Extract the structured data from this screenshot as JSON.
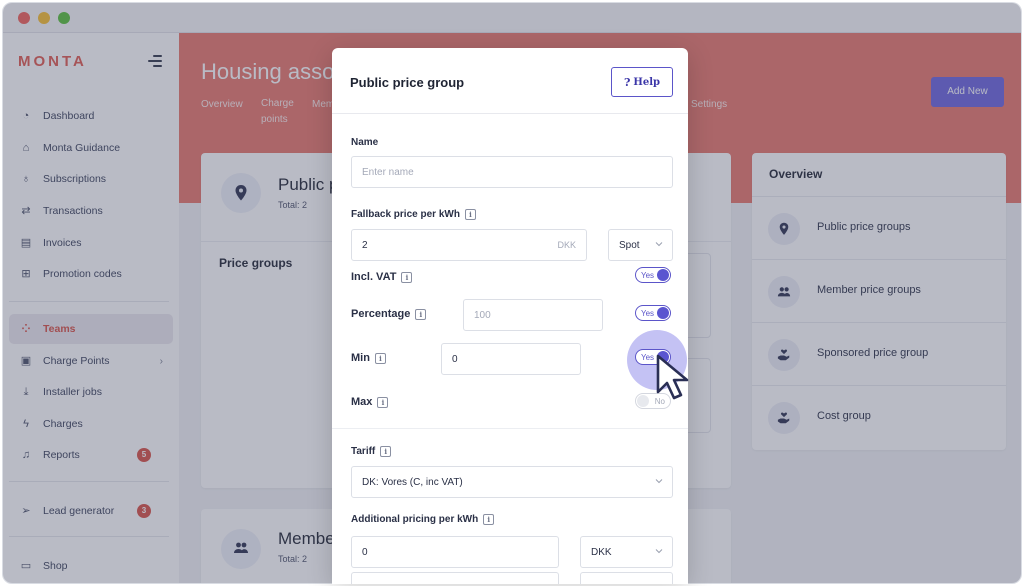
{
  "sidebar": {
    "logo": "MONTA",
    "items": [
      {
        "label": "Dashboard",
        "icon": "dashboard-icon"
      },
      {
        "label": "Monta Guidance",
        "icon": "home-icon"
      },
      {
        "label": "Subscriptions",
        "icon": "bulb-icon"
      },
      {
        "label": "Transactions",
        "icon": "transfer-icon"
      },
      {
        "label": "Invoices",
        "icon": "invoice-icon"
      },
      {
        "label": "Promotion codes",
        "icon": "gift-icon"
      },
      {
        "label": "Teams",
        "icon": "grid-icon",
        "active": true
      },
      {
        "label": "Charge Points",
        "icon": "charge-point-icon"
      },
      {
        "label": "Installer jobs",
        "icon": "download-icon"
      },
      {
        "label": "Charges",
        "icon": "bolt-icon"
      },
      {
        "label": "Reports",
        "icon": "bell-icon",
        "badge": "5"
      },
      {
        "label": "Lead generator",
        "icon": "send-icon",
        "badge": "3"
      },
      {
        "label": "Shop",
        "icon": "shop-icon"
      }
    ]
  },
  "header": {
    "title": "Housing asso",
    "tabs": [
      "Overview",
      "Charge points",
      "Mem",
      "Settings"
    ],
    "add_new": "Add New"
  },
  "content": {
    "public_card_title": "Public p",
    "public_card_total": "Total: 2",
    "price_groups": "Price groups",
    "member_card_title": "Member",
    "member_card_total": "Total: 2"
  },
  "overview": {
    "title": "Overview",
    "items": [
      "Public price groups",
      "Member price groups",
      "Sponsored price group",
      "Cost group"
    ]
  },
  "modal": {
    "title": "Public price group",
    "help": "Help",
    "help_mark": "?",
    "name_label": "Name",
    "name_placeholder": "Enter name",
    "fallback_label": "Fallback price per kWh",
    "fallback_value": "2",
    "fallback_currency": "DKK",
    "fallback_type": "Spot",
    "incl_vat_label": "Incl. VAT",
    "incl_vat_toggle": "Yes",
    "percentage_label": "Percentage",
    "percentage_placeholder": "100",
    "percentage_toggle": "Yes",
    "min_label": "Min",
    "min_value": "0",
    "min_toggle": "Yes",
    "max_label": "Max",
    "max_toggle": "No",
    "tariff_label": "Tariff",
    "tariff_value": "DK: Vores (C, inc VAT)",
    "additional_label": "Additional pricing per kWh",
    "additional_value": "0",
    "additional_currency": "DKK",
    "info_mark": "i"
  },
  "colors": {
    "accent": "#5b55c9",
    "brand": "#e05a4f",
    "hero": "#e8766b"
  }
}
